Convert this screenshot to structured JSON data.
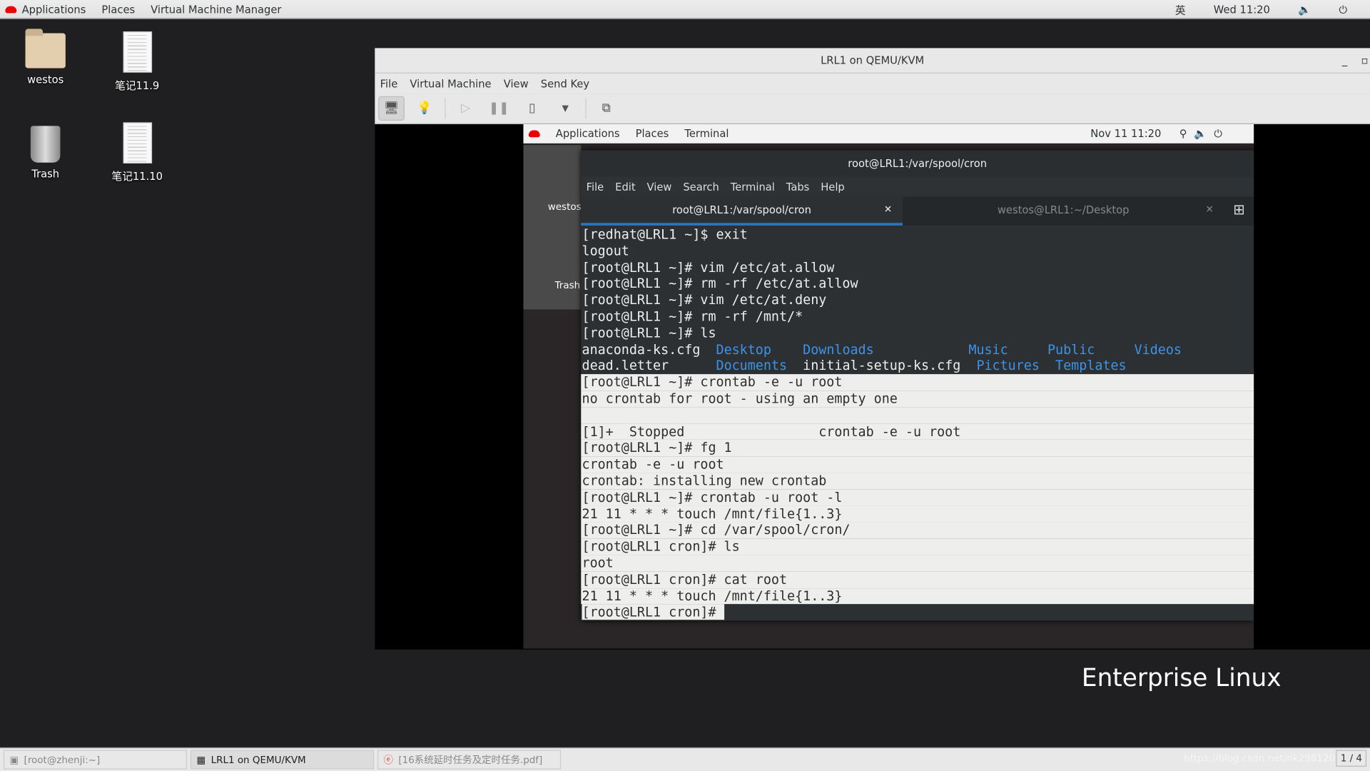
{
  "topbar": {
    "applications": "Applications",
    "places": "Places",
    "app": "Virtual Machine Manager",
    "ime": "英",
    "clock": "Wed 11:20"
  },
  "desktop": [
    {
      "label": "westos",
      "icon": "home-folder-icon"
    },
    {
      "label": "笔记11.9",
      "icon": "document-icon"
    },
    {
      "label": "Trash",
      "icon": "trash-icon"
    },
    {
      "label": "笔记11.10",
      "icon": "document-icon"
    }
  ],
  "vm": {
    "title": "LRL1 on QEMU/KVM",
    "menu": [
      "File",
      "Virtual Machine",
      "View",
      "Send Key"
    ]
  },
  "guest": {
    "applications": "Applications",
    "places": "Places",
    "terminal": "Terminal",
    "clock": "Nov 11  11:20",
    "icons": [
      "westos",
      "Trash"
    ],
    "term": {
      "title": "root@LRL1:/var/spool/cron",
      "menu": [
        "File",
        "Edit",
        "View",
        "Search",
        "Terminal",
        "Tabs",
        "Help"
      ],
      "tabs": [
        {
          "label": "root@LRL1:/var/spool/cron",
          "active": true
        },
        {
          "label": "westos@LRL1:~/Desktop",
          "active": false
        }
      ],
      "lines": [
        [
          {
            "t": "[redhat@LRL1 ~]$ exit"
          }
        ],
        [
          {
            "t": "logout"
          }
        ],
        [
          {
            "t": "[root@LRL1 ~]# vim /etc/at.allow"
          }
        ],
        [
          {
            "t": "[root@LRL1 ~]# rm -rf /etc/at.allow"
          }
        ],
        [
          {
            "t": "[root@LRL1 ~]# vim /etc/at.deny"
          }
        ],
        [
          {
            "t": "[root@LRL1 ~]# rm -rf /mnt/*"
          }
        ],
        [
          {
            "t": "[root@LRL1 ~]# ls"
          }
        ],
        [
          {
            "t": "anaconda-ks.cfg  "
          },
          {
            "t": "Desktop",
            "d": 1
          },
          {
            "t": "    "
          },
          {
            "t": "Downloads",
            "d": 1
          },
          {
            "t": "            "
          },
          {
            "t": "Music",
            "d": 1
          },
          {
            "t": "     "
          },
          {
            "t": "Public",
            "d": 1
          },
          {
            "t": "     "
          },
          {
            "t": "Videos",
            "d": 1
          }
        ],
        [
          {
            "t": "dead.letter      "
          },
          {
            "t": "Documents",
            "d": 1
          },
          {
            "t": "  initial-setup-ks.cfg  "
          },
          {
            "t": "Pictures",
            "d": 1
          },
          {
            "t": "  "
          },
          {
            "t": "Templates",
            "d": 1
          }
        ],
        [
          {
            "t": "[root@LRL1 ~]# crontab -e -u root"
          }
        ],
        [
          {
            "t": "no crontab for root - using an empty one"
          }
        ],
        [
          {
            "t": ""
          }
        ],
        [
          {
            "t": "[1]+  Stopped                 crontab -e -u root"
          }
        ],
        [
          {
            "t": "[root@LRL1 ~]# fg 1"
          }
        ],
        [
          {
            "t": "crontab -e -u root"
          }
        ],
        [
          {
            "t": "crontab: installing new crontab"
          }
        ],
        [
          {
            "t": "[root@LRL1 ~]# crontab -u root -l"
          }
        ],
        [
          {
            "t": "21 11 * * * touch /mnt/file{1..3}"
          }
        ],
        [
          {
            "t": "[root@LRL1 ~]# cd /var/spool/cron/"
          }
        ],
        [
          {
            "t": "[root@LRL1 cron]# ls"
          }
        ],
        [
          {
            "t": "root"
          }
        ],
        [
          {
            "t": "[root@LRL1 cron]# cat root"
          }
        ],
        [
          {
            "t": "21 11 * * * touch /mnt/file{1..3}"
          }
        ],
        [
          {
            "t": "[root@LRL1 cron]# ",
            "p": 1
          }
        ]
      ]
    }
  },
  "logo": {
    "line1": "Enterprise Linux",
    "line2": "Enterprise Linux"
  },
  "taskbar": [
    {
      "label": "[root@zhenji:~]"
    },
    {
      "label": "LRL1 on QEMU/KVM",
      "active": true
    },
    {
      "label": "[16系统延时任务及定时任务.pdf]"
    }
  ],
  "workspace": "1 / 4",
  "watermark": "https://blog.csdn.net/nk298120",
  "colors": {
    "accent": "#2a76c6",
    "dir": "#3a94ee",
    "redhat": "#ee0000"
  }
}
